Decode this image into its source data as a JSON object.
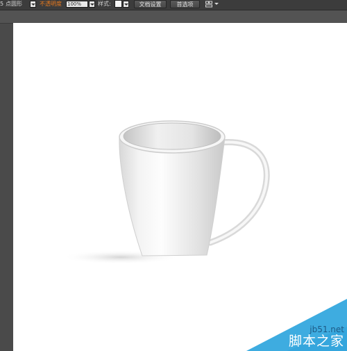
{
  "control_bar": {
    "stroke_weight": "5",
    "stroke_profile": "点圆形",
    "opacity_label": "不透明度",
    "opacity_value": "100%",
    "style_label": "样式:",
    "doc_setup_label": "文档设置",
    "preferences_label": "首选项"
  },
  "icons": {
    "arrange": "arrange-documents-icon",
    "dropdown": "chevron-down-icon"
  },
  "colors": {
    "toolbar_bg": "#3c3c3c",
    "opacity_label": "#e87a1e",
    "canvas": "#ffffff",
    "watermark_bg": "#35a6dd"
  },
  "watermark": {
    "url": "jb51.net",
    "name": "脚本之家"
  }
}
